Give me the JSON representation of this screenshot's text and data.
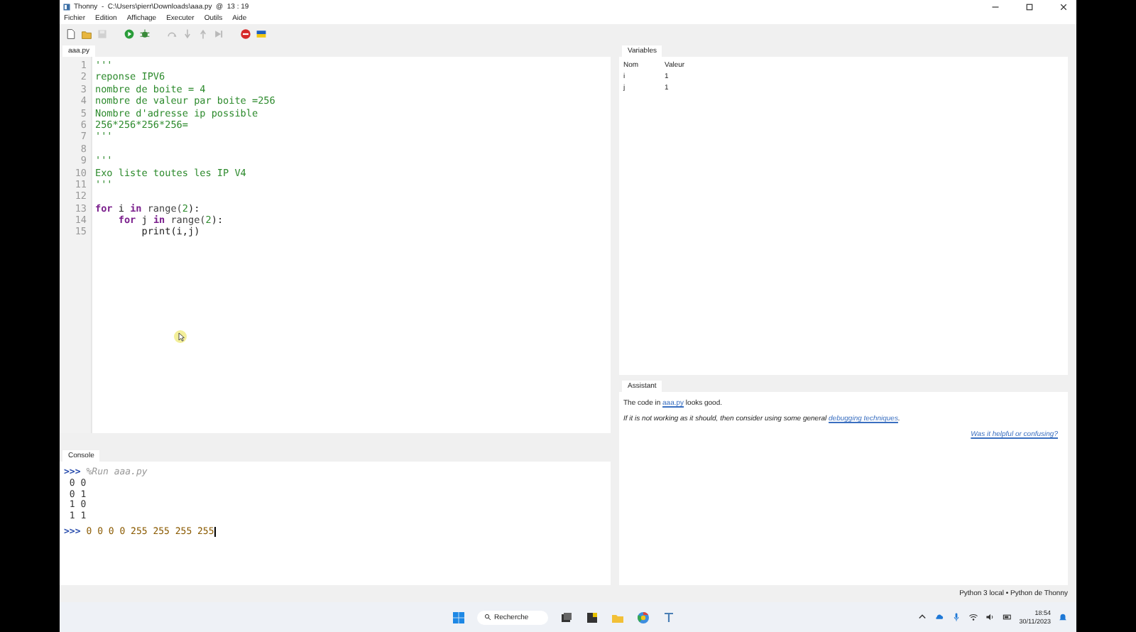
{
  "window": {
    "title": "Thonny  -  C:\\Users\\pierr\\Downloads\\aaa.py  @  13 : 19"
  },
  "menu": [
    "Fichier",
    "Edition",
    "Affichage",
    "Executer",
    "Outils",
    "Aide"
  ],
  "toolbar": [
    {
      "kind": "new",
      "disabled": false
    },
    {
      "kind": "open",
      "disabled": false
    },
    {
      "kind": "save",
      "disabled": true
    },
    {
      "kind": "run",
      "disabled": false
    },
    {
      "kind": "debug",
      "disabled": false
    },
    {
      "kind": "step-over",
      "disabled": true
    },
    {
      "kind": "step-into",
      "disabled": true
    },
    {
      "kind": "step-out",
      "disabled": true
    },
    {
      "kind": "resume",
      "disabled": true
    },
    {
      "kind": "stop",
      "disabled": false
    },
    {
      "kind": "flag",
      "disabled": false
    }
  ],
  "editor": {
    "tabs": [
      {
        "label": "aaa.py",
        "selected": true
      }
    ],
    "lines": [
      {
        "number": "1",
        "tokens": [
          {
            "kind": "string",
            "text": "'''"
          }
        ]
      },
      {
        "number": "2",
        "tokens": [
          {
            "kind": "string",
            "text": "reponse IPV6"
          }
        ]
      },
      {
        "number": "3",
        "tokens": [
          {
            "kind": "string",
            "text": "nombre de boite = 4"
          }
        ]
      },
      {
        "number": "4",
        "tokens": [
          {
            "kind": "string",
            "text": "nombre de valeur par boite =256"
          }
        ]
      },
      {
        "number": "5",
        "tokens": [
          {
            "kind": "string",
            "text": "Nombre d'adresse ip possible"
          }
        ]
      },
      {
        "number": "6",
        "tokens": [
          {
            "kind": "string",
            "text": "256*256*256*256="
          }
        ]
      },
      {
        "number": "7",
        "tokens": [
          {
            "kind": "string",
            "text": "'''"
          }
        ]
      },
      {
        "number": "8"
      },
      {
        "number": "9",
        "tokens": [
          {
            "kind": "string",
            "text": "'''"
          }
        ]
      },
      {
        "number": "10",
        "tokens": [
          {
            "kind": "string",
            "text": "Exo liste toutes les IP V4"
          }
        ]
      },
      {
        "number": "11",
        "tokens": [
          {
            "kind": "string",
            "text": "'''"
          }
        ]
      },
      {
        "number": "12"
      },
      {
        "number": "13",
        "tokens": [
          {
            "kind": "keyword",
            "text": "for"
          },
          {
            "kind": "plain",
            "text": " i "
          },
          {
            "kind": "keyword",
            "text": "in"
          },
          {
            "kind": "builtin",
            "text": " range("
          },
          {
            "kind": "number",
            "text": "2"
          },
          {
            "kind": "plain",
            "text": "):"
          }
        ]
      },
      {
        "number": "14",
        "tokens": [
          {
            "kind": "keyword",
            "text": "    for"
          },
          {
            "kind": "plain",
            "text": " j "
          },
          {
            "kind": "keyword",
            "text": "in"
          },
          {
            "kind": "builtin",
            "text": " range("
          },
          {
            "kind": "number",
            "text": "2"
          },
          {
            "kind": "plain",
            "text": "):"
          }
        ]
      },
      {
        "number": "15",
        "tokens": [
          {
            "kind": "plain",
            "text": "        print(i,j)"
          }
        ]
      }
    ]
  },
  "console": {
    "tab": {
      "label": "Console",
      "selected": true
    },
    "lines": [
      {
        "kind": "command",
        "prompt": ">>>",
        "text": "%Run aaa.py"
      },
      {
        "kind": "output",
        "text": " 0 0"
      },
      {
        "kind": "output",
        "text": " 0 1"
      },
      {
        "kind": "output",
        "text": " 1 0"
      },
      {
        "kind": "output",
        "text": " 1 1"
      },
      {
        "kind": "input",
        "prompt": ">>>",
        "text": "0 0 0 0 255 255 255 255"
      }
    ]
  },
  "variables": {
    "tab": {
      "label": "Variables",
      "selected": true
    },
    "columns": [
      "Nom",
      "Valeur"
    ],
    "rows": [
      {
        "name": "i",
        "value": "1"
      },
      {
        "name": "j",
        "value": "1"
      }
    ]
  },
  "assistant": {
    "tab": {
      "label": "Assistant",
      "selected": true
    },
    "line_1": {
      "before": "The code in ",
      "link": "aaa.py",
      "after": " looks good."
    },
    "line_2": {
      "before": "If it is not working as it should, then consider using some general ",
      "link": "debugging techniques",
      "after": "."
    },
    "feedback_link": "Was it helpful or confusing?"
  },
  "status_bar": {
    "interpreter": "Python 3 local  •  Python de Thonny"
  },
  "taskbar": {
    "search": "Recherche",
    "time": "18:54",
    "date": "30/11/2023"
  }
}
